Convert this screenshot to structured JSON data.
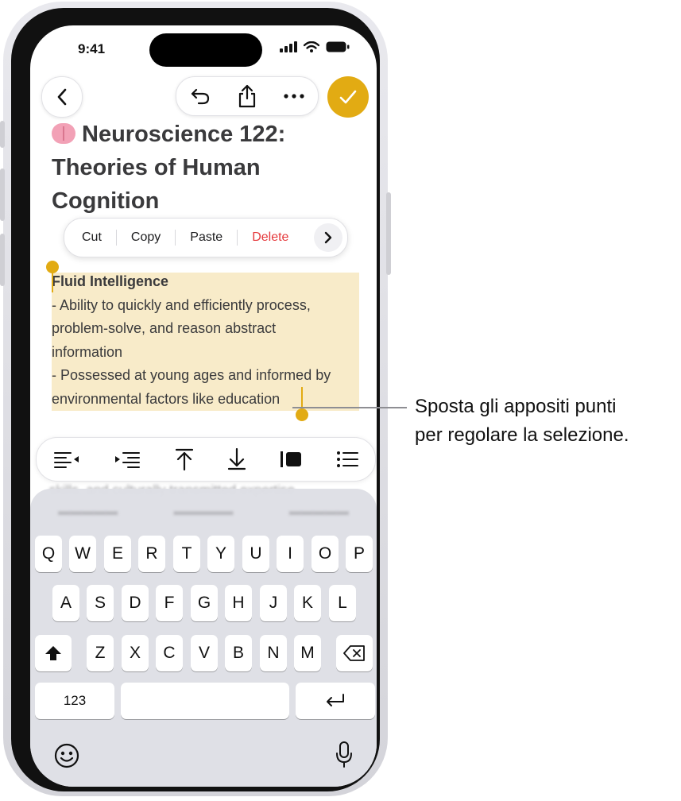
{
  "status_bar": {
    "time": "9:41"
  },
  "note": {
    "title": "Neuroscience 122: Theories of Human Cognition",
    "selected_heading": "Fluid Intelligence",
    "lines": [
      "- Ability to quickly and efficiently process,",
      "problem-solve, and reason abstract",
      "information",
      "- Possessed at young ages and informed by",
      "environmental factors like education"
    ],
    "behind_text": "skills, and culturally transmitted expertise"
  },
  "edit_menu": {
    "cut": "Cut",
    "copy": "Copy",
    "paste": "Paste",
    "delete": "Delete"
  },
  "keyboard": {
    "row1": [
      "Q",
      "W",
      "E",
      "R",
      "T",
      "Y",
      "U",
      "I",
      "O",
      "P"
    ],
    "row2": [
      "A",
      "S",
      "D",
      "F",
      "G",
      "H",
      "J",
      "K",
      "L"
    ],
    "row3": [
      "Z",
      "X",
      "C",
      "V",
      "B",
      "N",
      "M"
    ],
    "numbers_label": "123"
  },
  "callout": {
    "line1": "Sposta gli appositi punti",
    "line2": "per regolare la selezione."
  },
  "colors": {
    "accent": "#e2ab13",
    "selection": "#f8ebc9",
    "delete": "#e5383b"
  },
  "icons": [
    "back-chevron-icon",
    "undo-icon",
    "share-icon",
    "more-icon",
    "checkmark-icon",
    "chevron-right-icon",
    "outdent-icon",
    "indent-icon",
    "move-up-icon",
    "move-down-icon",
    "block-quote-icon",
    "bulleted-list-icon",
    "shift-icon",
    "delete-key-icon",
    "return-icon",
    "emoji-icon",
    "microphone-icon"
  ]
}
